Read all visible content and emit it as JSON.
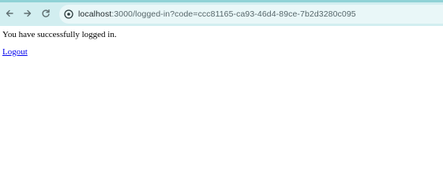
{
  "browser": {
    "url_host": "localhost",
    "url_path": ":3000/logged-in?code=ccc81165-ca93-46d4-89ce-7b2d3280c095",
    "icons": {
      "back": "arrow-left-icon",
      "forward": "arrow-right-icon",
      "reload": "reload-icon",
      "site_info": "site-info-icon"
    }
  },
  "page": {
    "message": "You have successfully logged in.",
    "logout_label": "Logout"
  },
  "colors": {
    "toolbar_bg": "#d2eef0",
    "toolbar_top_border": "#8fd2d6",
    "address_bar_bg": "#e9f7f8",
    "link": "#0000ee"
  }
}
